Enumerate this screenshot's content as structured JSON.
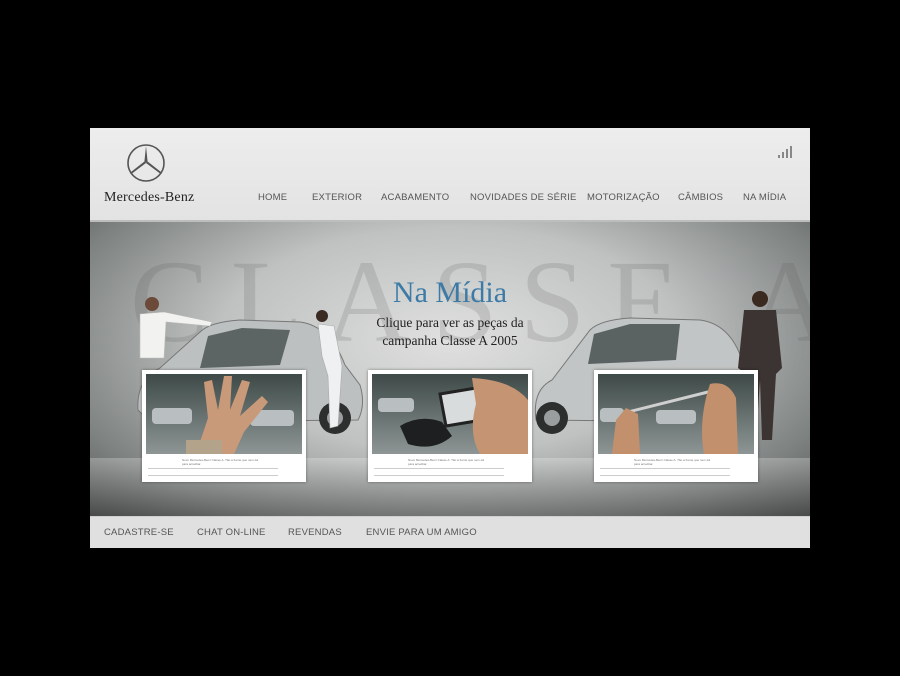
{
  "brand": {
    "name": "Mercedes-Benz"
  },
  "nav": {
    "items": [
      "HOME",
      "EXTERIOR",
      "ACABAMENTO",
      "NOVIDADES DE SÉRIE",
      "MOTORIZAÇÃO",
      "CÂMBIOS",
      "NA MÍDIA"
    ]
  },
  "hero": {
    "background_word": "CLASSE A",
    "title": "Na Mídia",
    "subtitle_line1": "Clique para ver as peças da",
    "subtitle_line2": "campanha Classe A 2005"
  },
  "ads": [
    {
      "caption": "Novo Mercedes-Benz Classe A. Tão à frente que nem dá para acreditar."
    },
    {
      "caption": "Novo Mercedes-Benz Classe A. Tão à frente que nem dá para acreditar."
    },
    {
      "caption": "Novo Mercedes-Benz Classe A. Tão à frente que nem dá para acreditar."
    }
  ],
  "footer": {
    "links": [
      "CADASTRE-SE",
      "CHAT ON-LINE",
      "REVENDAS",
      "ENVIE PARA UM AMIGO"
    ]
  },
  "colors": {
    "title_blue": "#3d7aa6",
    "nav_text": "#555555",
    "page_bg": "#000000"
  },
  "icons": [
    "mercedes-star-logo",
    "sound-bars-icon"
  ]
}
